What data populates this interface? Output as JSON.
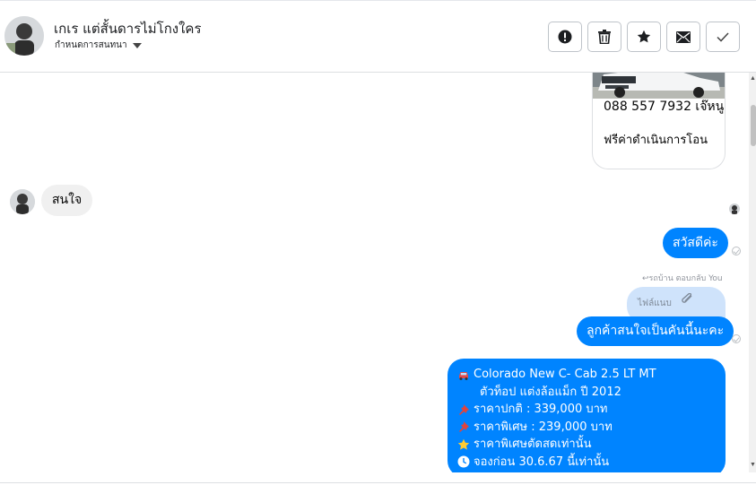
{
  "header": {
    "contact_name": "เกเร แต่สั้นดารไม่โกงใคร",
    "subtitle": "กำหนดการสนทนา",
    "actions": [
      {
        "name": "mark-spam-button",
        "icon": "exclamation-icon"
      },
      {
        "name": "delete-button",
        "icon": "trash-icon"
      },
      {
        "name": "star-button",
        "icon": "star-icon"
      },
      {
        "name": "mark-unread-button",
        "icon": "envelope-icon"
      },
      {
        "name": "mark-done-button",
        "icon": "checkmark-icon"
      }
    ]
  },
  "messages": {
    "card": {
      "phone": "088 557 7932 เจ๊หนู",
      "fee": "ฟรีค่าดำเนินการโอน"
    },
    "incoming": "สนใจ",
    "outgoing_1": "สวัสดีค่ะ",
    "reply_note": "รถบ้าน ตอบกลับ You",
    "reply_attachment": "ไฟล์แนบ",
    "outgoing_2": "ลูกค้าสนใจเป็นคันนี้นะคะ",
    "listing": {
      "line1": "Colorado New C- Cab 2.5 LT MT",
      "line2": "ตัวท็อป แต่งล้อแม็ก ปี 2012",
      "line3": "ราคาปกติ : 339,000 บาท",
      "line4": "ราคาพิเศษ : 239,000 บาท",
      "line5": "ราคาพิเศษตัดสดเท่านั้น",
      "line6": "จองก่อน 30.6.67 นี้เท่านั้น"
    }
  },
  "colors": {
    "outgoing_bubble": "#0084ff",
    "incoming_bubble": "#f0f0f0",
    "reply_bubble": "#cfe3fb"
  }
}
